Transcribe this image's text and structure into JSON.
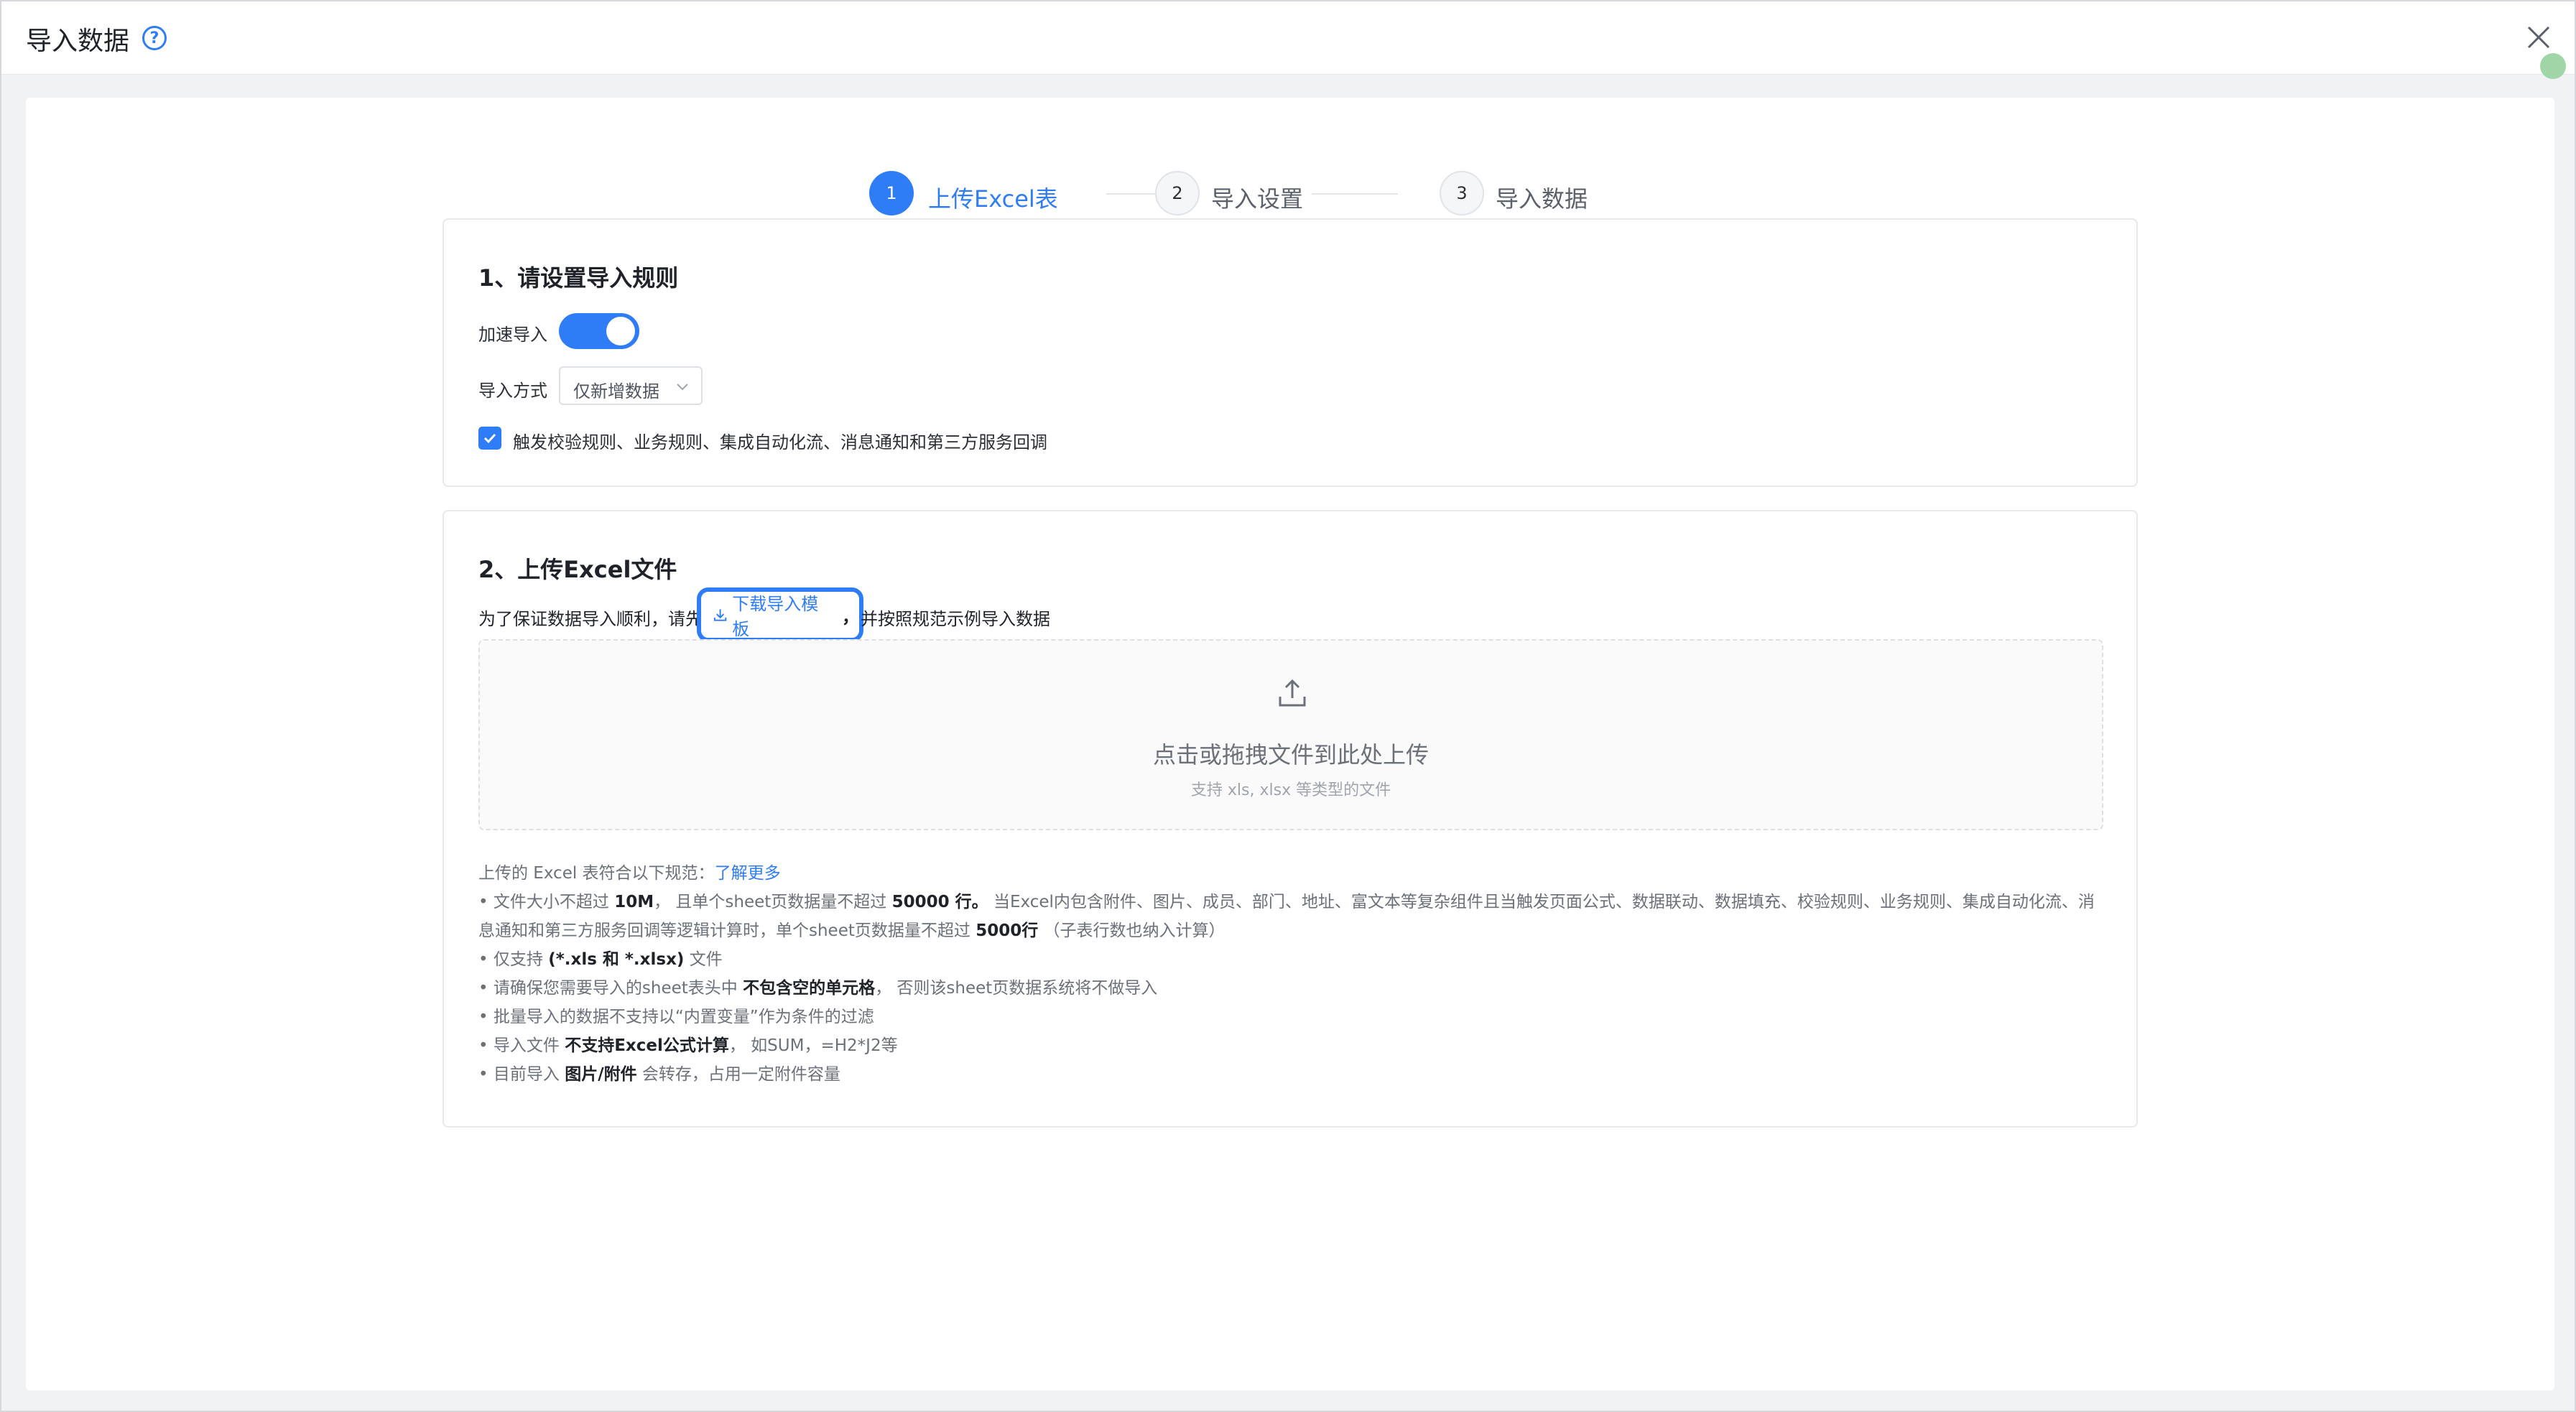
{
  "window": {
    "title": "导入数据",
    "help_glyph": "?"
  },
  "stepper": {
    "steps": [
      {
        "number": "1",
        "label": "上传Excel表",
        "state": "active"
      },
      {
        "number": "2",
        "label": "导入设置",
        "state": "idle"
      },
      {
        "number": "3",
        "label": "导入数据",
        "state": "idle"
      }
    ]
  },
  "section1": {
    "title": "1、请设置导入规则",
    "accelerate_label": "加速导入",
    "accelerate_on": true,
    "import_mode_label": "导入方式",
    "import_mode_value": "仅新增数据",
    "trigger_checkbox_label": "触发校验规则、业务规则、集成自动化流、消息通知和第三方服务回调",
    "trigger_checked": true
  },
  "section2": {
    "title": "2、上传Excel文件",
    "intro_prefix": "为了保证数据导入顺利，请先",
    "download_template": "下载导入模板",
    "comma": "，",
    "intro_suffix": "并按照规范示例导入数据",
    "dropzone_main": "点击或拖拽文件到此处上传",
    "dropzone_sub": "支持 xls, xlsx 等类型的文件"
  },
  "rules": {
    "heading": "上传的 Excel 表符合以下规范：",
    "learn_more": "了解更多",
    "r1_a": "• 文件大小不超过 ",
    "r1_b": "10M",
    "r1_c": "， 且单个sheet页数据量不超过 ",
    "r1_d": "50000 行。",
    "r1_e": " 当Excel内包含附件、图片、成员、部门、地址、富文本等复杂组件且当触发页面公式、数据联动、数据填充、校验规则、业务规则、集成自动化流、消息通知和第三方服务回调等逻辑计算时，单个sheet页数据量不超过 ",
    "r1_f": "5000行",
    "r1_g": " （子表行数也纳入计算）",
    "r2_a": "• 仅支持 ",
    "r2_b": "(*.xls 和 *.xlsx)",
    "r2_c": " 文件",
    "r3_a": "• 请确保您需要导入的sheet表头中 ",
    "r3_b": "不包含空的单元格",
    "r3_c": "， 否则该sheet页数据系统将不做导入",
    "r4": "• 批量导入的数据不支持以“内置变量”作为条件的过滤",
    "r5_a": "• 导入文件 ",
    "r5_b": "不支持Excel公式计算",
    "r5_c": "， 如SUM，=H2*J2等",
    "r6_a": "• 目前导入 ",
    "r6_b": "图片/附件",
    "r6_c": " 会转存，占用一定附件容量"
  },
  "colors": {
    "accent": "#2f7df6",
    "text": "#1f2329",
    "muted": "#6b7079"
  }
}
